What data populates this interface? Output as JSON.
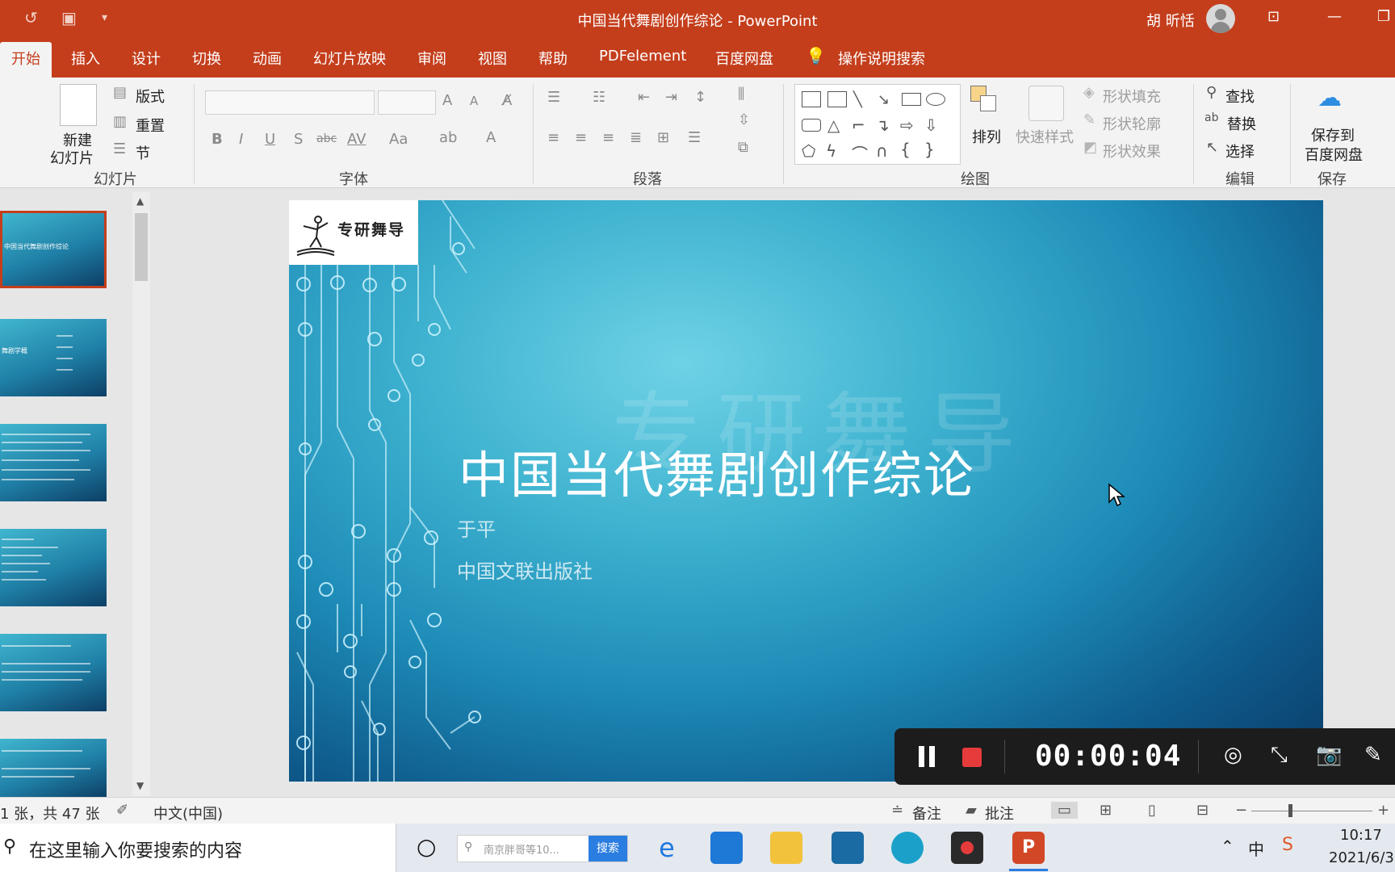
{
  "window": {
    "title": "中国当代舞剧创作综论 - PowerPoint",
    "user": "胡 昕恬"
  },
  "tabs": [
    "开始",
    "插入",
    "设计",
    "切换",
    "动画",
    "幻灯片放映",
    "审阅",
    "视图",
    "帮助",
    "PDFelement",
    "百度网盘",
    "操作说明搜索"
  ],
  "ribbon": {
    "slides": {
      "new_slide": "新建",
      "new_slide2": "幻灯片",
      "layout": "版式",
      "reset": "重置",
      "section": "节",
      "label": "幻灯片"
    },
    "font": {
      "label": "字体",
      "bold": "B",
      "italic": "I",
      "underline": "U",
      "shadow": "S",
      "strike": "abc",
      "spacing": "AV",
      "case": "Aa",
      "grow": "A",
      "shrink": "A"
    },
    "paragraph": {
      "label": "段落"
    },
    "drawing": {
      "arrange": "排列",
      "quick_styles": "快速样式",
      "shape_fill": "形状填充",
      "shape_outline": "形状轮廓",
      "shape_effects": "形状效果",
      "label": "绘图"
    },
    "editing": {
      "find": "查找",
      "replace": "替换",
      "select": "选择",
      "label": "编辑"
    },
    "save": {
      "save_to": "保存到",
      "baidu": "百度网盘",
      "label": "保存"
    }
  },
  "slide": {
    "logo": "专研舞导",
    "watermark": "专研舞导",
    "title": "中国当代舞剧创作综论",
    "author": "于平",
    "publisher": "中国文联出版社"
  },
  "thumbnails": {
    "t1": "中国当代舞剧创作综论",
    "t2": "舞剧学概"
  },
  "recorder": {
    "time": "00:00:04"
  },
  "status": {
    "slide_count": "1 张，共 47 张",
    "language": "中文(中国)",
    "notes": "备注",
    "comments": "批注"
  },
  "taskbar": {
    "search_placeholder": "在这里输入你要搜索的内容",
    "mini_search": "南京胖哥等10...",
    "mini_button": "搜索",
    "ime": "中",
    "time": "10:17",
    "date": "2021/6/3"
  },
  "colors": {
    "accent": "#c43e1c",
    "recorder_stop": "#e63b3b"
  }
}
